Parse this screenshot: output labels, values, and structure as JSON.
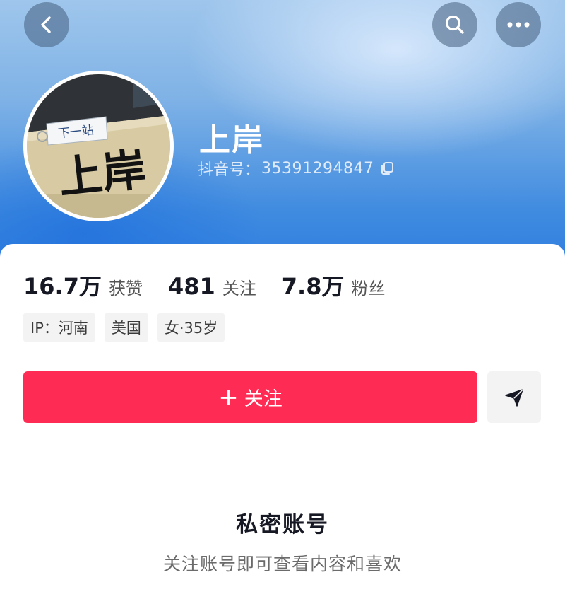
{
  "profile": {
    "name": "上岸",
    "douyin_id_label": "抖音号：",
    "douyin_id": "35391294847",
    "avatar_text_small": "下一站",
    "avatar_text_big": "上岸"
  },
  "stats": [
    {
      "value": "16.7万",
      "label": "获赞"
    },
    {
      "value": "481",
      "label": "关注"
    },
    {
      "value": "7.8万",
      "label": "粉丝"
    }
  ],
  "tags": [
    "IP：河南",
    "美国",
    "女·35岁"
  ],
  "actions": {
    "follow_plus": "+",
    "follow_label": "关注"
  },
  "private": {
    "title": "私密账号",
    "subtitle": "关注账号即可查看内容和喜欢"
  },
  "icons": {
    "back": "chevron-left-icon",
    "search": "search-icon",
    "more": "more-dots-icon",
    "copy": "copy-icon",
    "share": "send-arrow-icon"
  },
  "colors": {
    "accent": "#fe2c55",
    "header_blue": "#2a7ae0"
  }
}
